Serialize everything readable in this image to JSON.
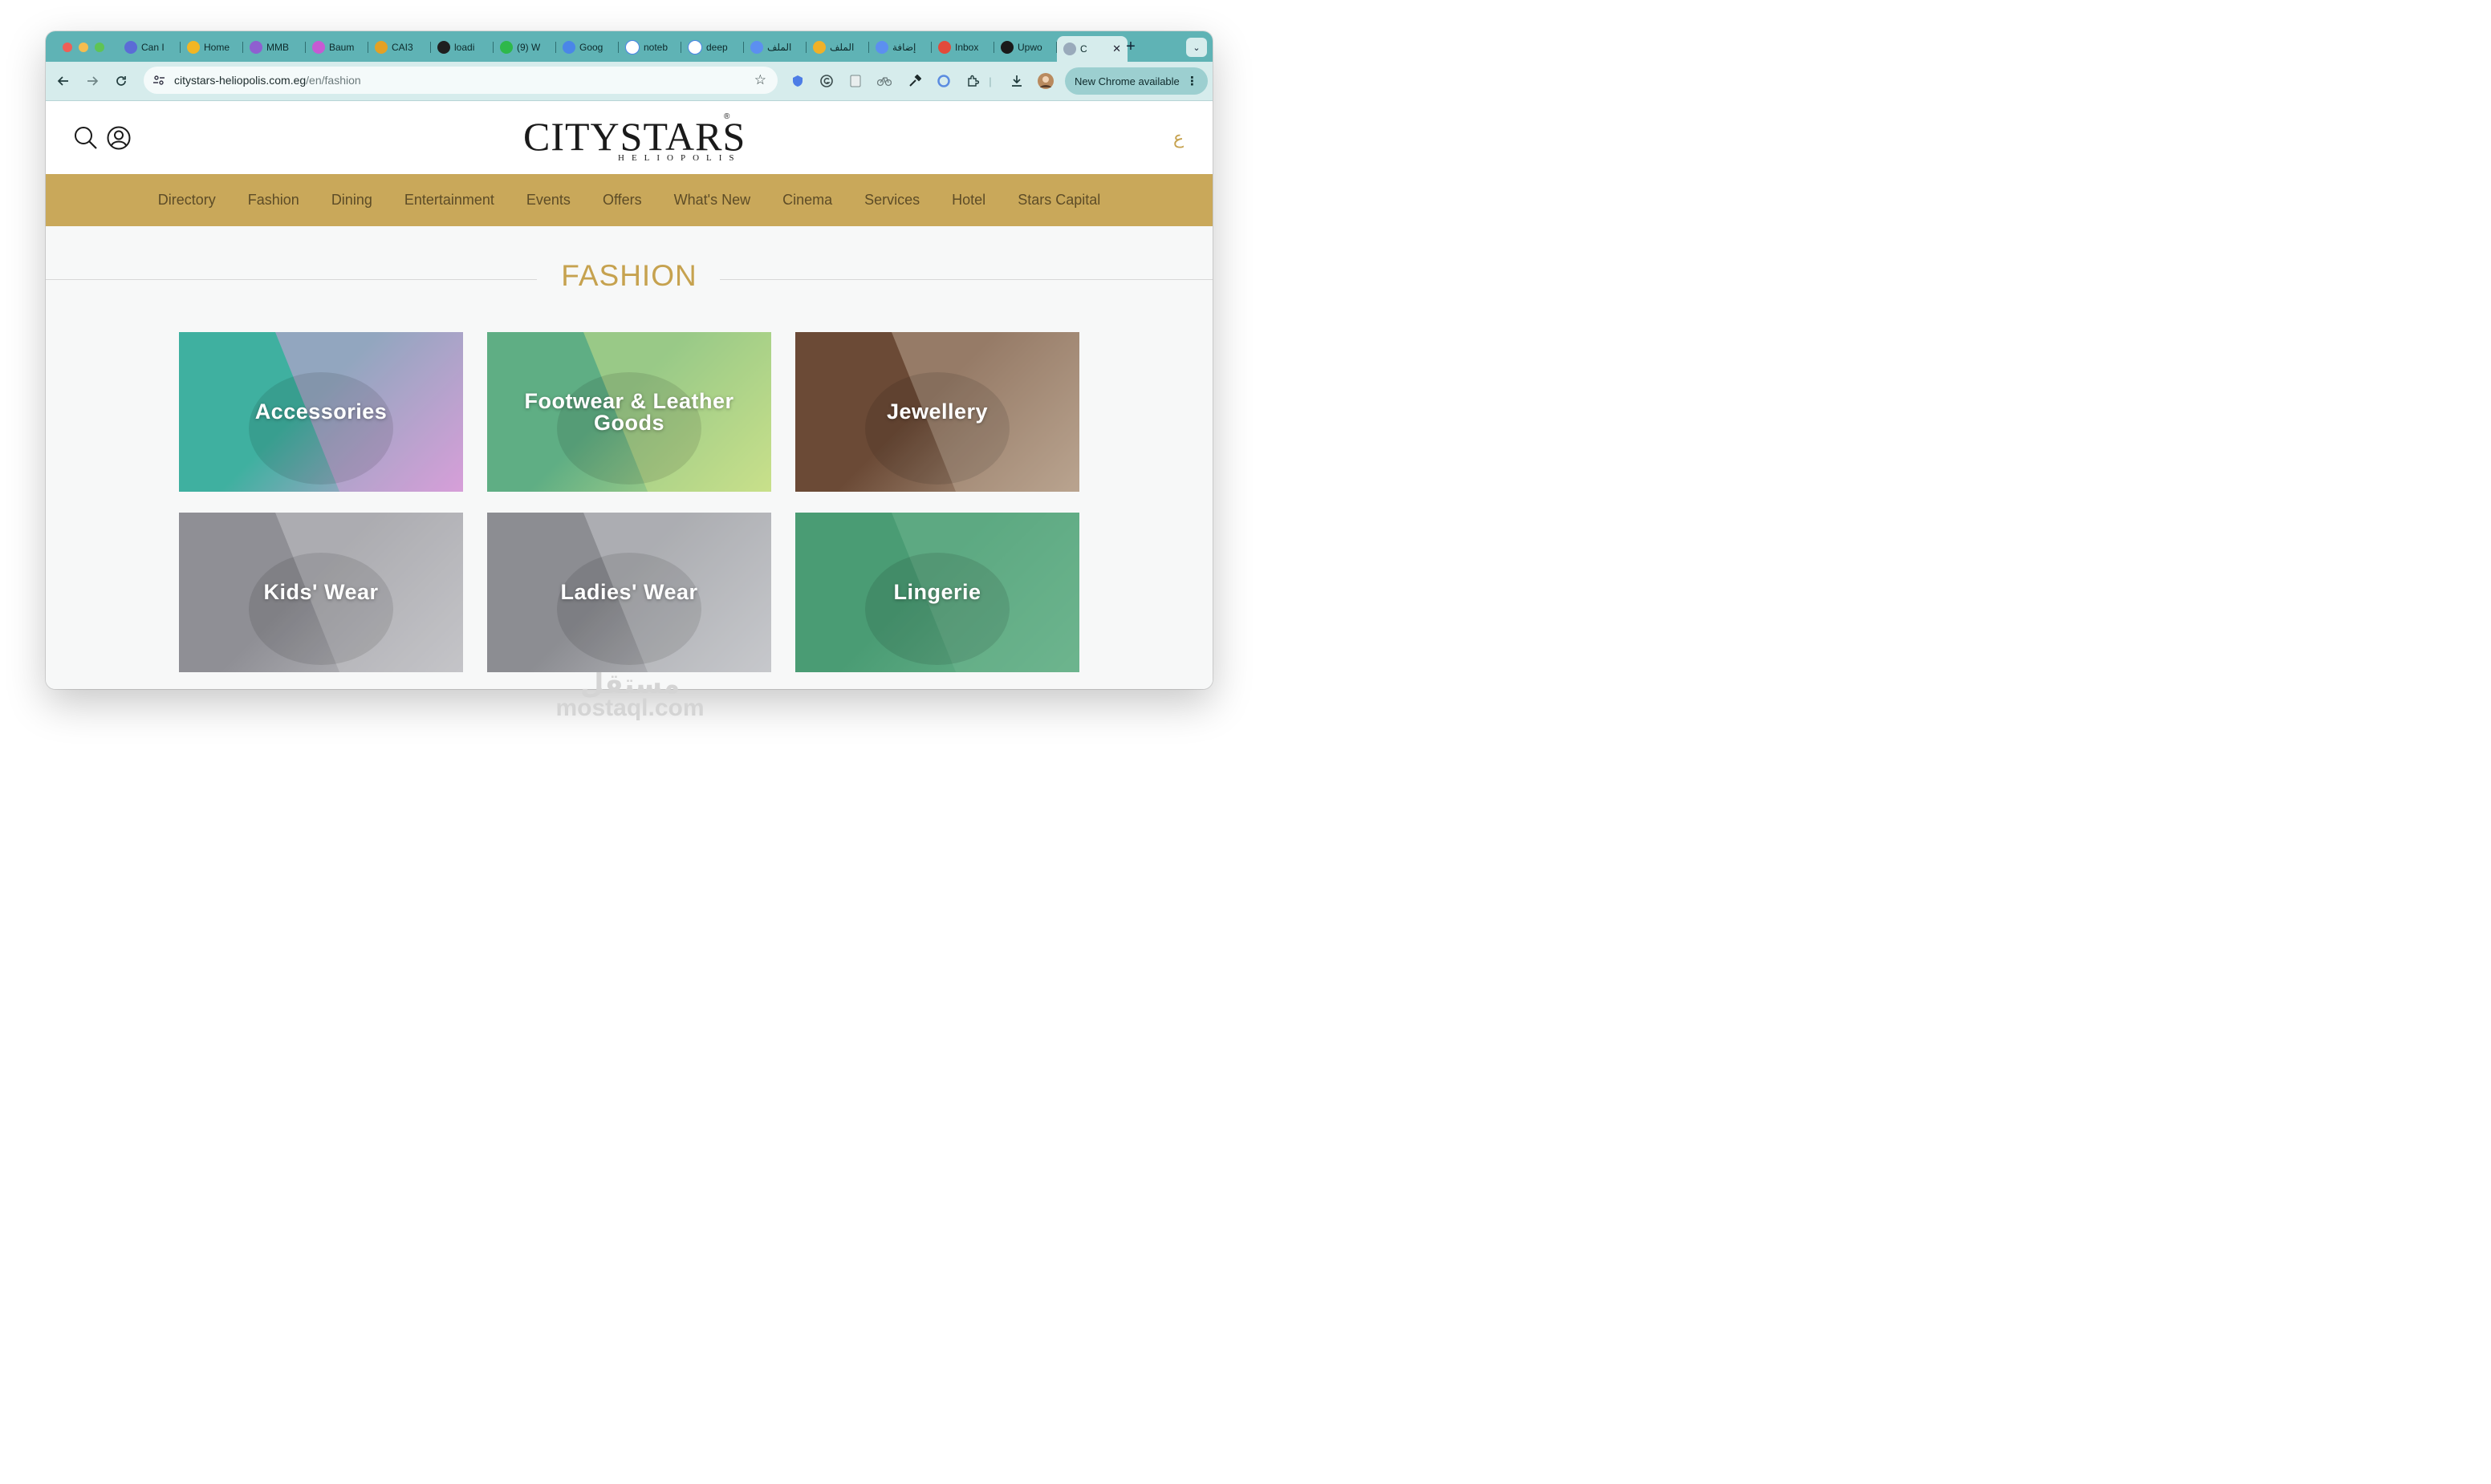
{
  "browser": {
    "tabs": [
      {
        "title": "Can I",
        "icon": "globe-icon",
        "color": "#5b6cd6"
      },
      {
        "title": "Home",
        "icon": "smiley-icon",
        "color": "#f2b624"
      },
      {
        "title": "MMB",
        "icon": "spinner-icon",
        "color": "#8f5fd0"
      },
      {
        "title": "Baum",
        "icon": "spinner-icon",
        "color": "#c65ad3"
      },
      {
        "title": "CAI3",
        "icon": "chart-icon",
        "color": "#e4a124"
      },
      {
        "title": "loadi",
        "icon": "github-icon",
        "color": "#1f1f1f"
      },
      {
        "title": "(9) W",
        "icon": "whatsapp-icon",
        "color": "#2eb84b"
      },
      {
        "title": "Goog",
        "icon": "translate-icon",
        "color": "#4a86e8"
      },
      {
        "title": "noteb",
        "icon": "google-icon",
        "color": "#ffffff"
      },
      {
        "title": "deep",
        "icon": "google-icon",
        "color": "#ffffff"
      },
      {
        "title": "الملف",
        "icon": "circle-icon",
        "color": "#5c8ff0"
      },
      {
        "title": "الملف",
        "icon": "number-five-icon",
        "color": "#f0b128"
      },
      {
        "title": "إضافة",
        "icon": "circle-icon",
        "color": "#5c8ff0"
      },
      {
        "title": "Inbox",
        "icon": "gmail-icon",
        "color": "#e24a3b"
      },
      {
        "title": "Upwo",
        "icon": "upwork-icon",
        "color": "#1a1a1a"
      }
    ],
    "active_tab": {
      "title": "C",
      "close": "✕"
    },
    "new_tab": "+",
    "tab_menu": "⌄",
    "url_host": "citystars-heliopolis.com.eg",
    "url_path": "/en/fashion",
    "update_button": "New Chrome available",
    "update_menu": "⋮"
  },
  "site": {
    "logo_text": "CITYSTARS",
    "logo_sub": "HELIOPOLIS",
    "logo_reg": "®",
    "lang_toggle": "ع",
    "menu": [
      "Directory",
      "Fashion",
      "Dining",
      "Entertainment",
      "Events",
      "Offers",
      "What's New",
      "Cinema",
      "Services",
      "Hotel",
      "Stars Capital"
    ],
    "section_title": "FASHION",
    "categories": [
      {
        "label": "Accessories",
        "colors": [
          "#3fb0a0",
          "#d79fd9"
        ]
      },
      {
        "label": "Footwear & Leather Goods",
        "colors": [
          "#5fae84",
          "#c9e08a"
        ]
      },
      {
        "label": "Jewellery",
        "colors": [
          "#6b4a36",
          "#b9a48f"
        ]
      },
      {
        "label": "Kids' Wear",
        "colors": [
          "#8f8f95",
          "#c4c4c8"
        ]
      },
      {
        "label": "Ladies' Wear",
        "colors": [
          "#8c8d92",
          "#c7c8cc"
        ]
      },
      {
        "label": "Lingerie",
        "colors": [
          "#4a9c74",
          "#6db58e"
        ]
      }
    ],
    "accent": "#c9a85a"
  },
  "watermark": {
    "arabic": "مستقل",
    "latin": "mostaql.com"
  }
}
